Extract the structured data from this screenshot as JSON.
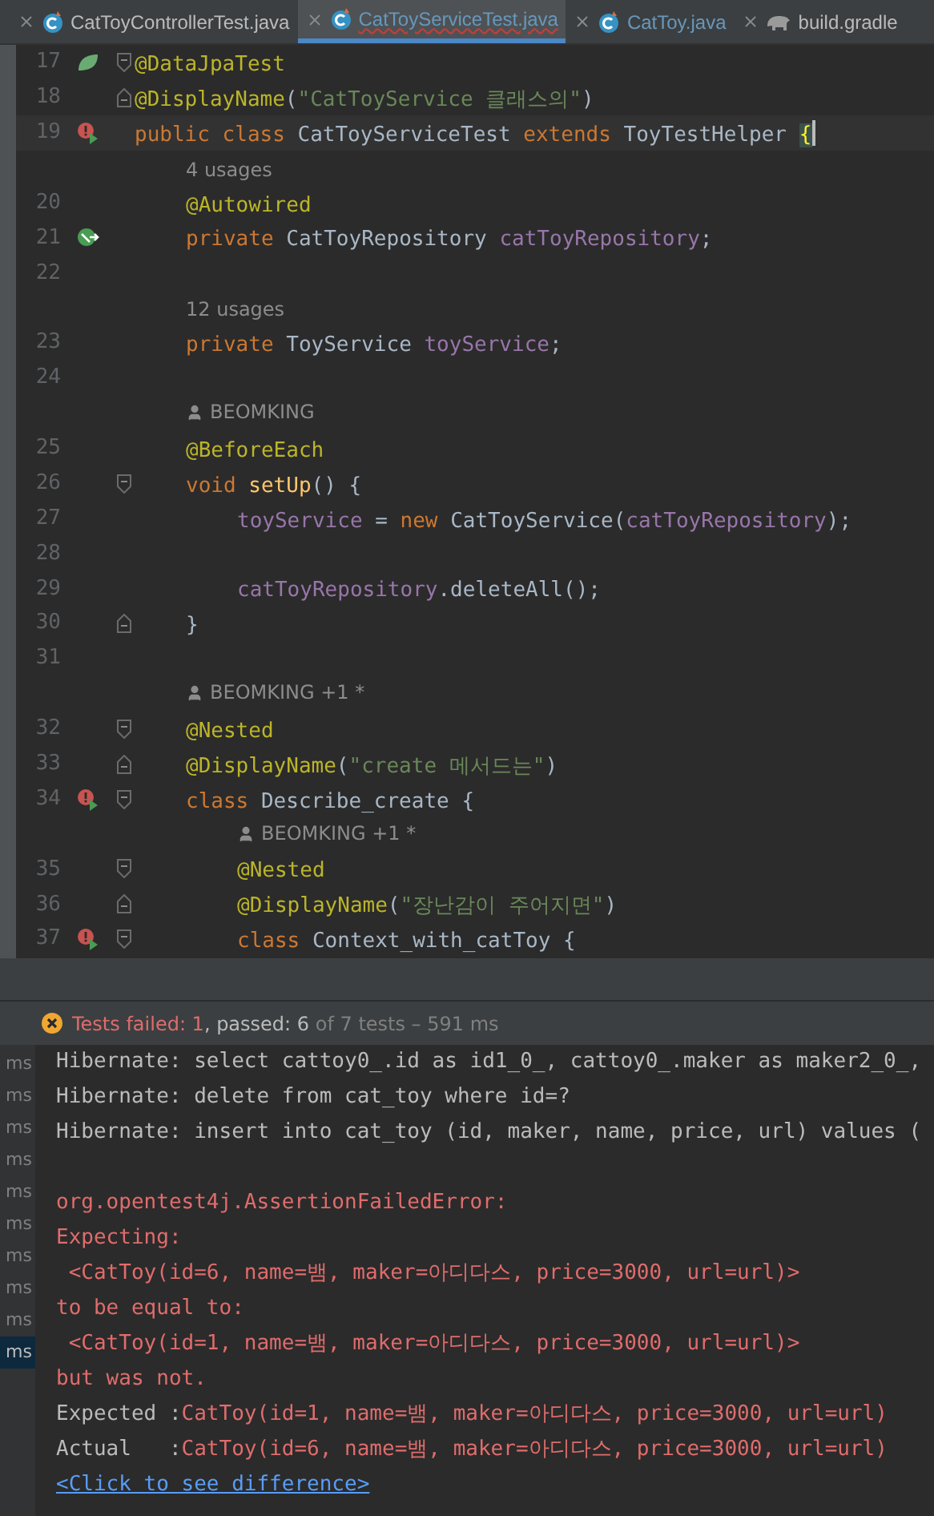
{
  "tabs": [
    {
      "label": "CatToyControllerTest.java",
      "kind": "class",
      "selected": false,
      "modified": false,
      "has_errors": false
    },
    {
      "label": "CatToyServiceTest.java",
      "kind": "class",
      "selected": true,
      "modified": true,
      "has_errors": true
    },
    {
      "label": "CatToy.java",
      "kind": "class",
      "selected": false,
      "modified": true,
      "has_errors": false
    },
    {
      "label": "build.gradle",
      "kind": "gradle",
      "selected": false,
      "modified": false,
      "has_errors": false
    }
  ],
  "editor": {
    "lines": [
      {
        "kind": "code",
        "number": "17",
        "gutter": {
          "kind": "spring"
        },
        "fold": {
          "kind": "start"
        },
        "current": false,
        "tokens": [
          {
            "kind": "ann",
            "text": "@DataJpaTest"
          }
        ]
      },
      {
        "kind": "code",
        "number": "18",
        "fold": {
          "kind": "end"
        },
        "current": false,
        "tokens": [
          {
            "kind": "ann",
            "text": "@DisplayName"
          },
          {
            "kind": "plain",
            "text": "("
          },
          {
            "kind": "str",
            "text": "\"CatToyService 클래스의\""
          },
          {
            "kind": "plain",
            "text": ")"
          }
        ]
      },
      {
        "kind": "code",
        "number": "19",
        "gutter": {
          "kind": "error-run"
        },
        "current": true,
        "tokens": [
          {
            "kind": "kw",
            "text": "public class "
          },
          {
            "kind": "plain",
            "text": "CatToyServiceTest "
          },
          {
            "kind": "kw",
            "text": "extends "
          },
          {
            "kind": "plain",
            "text": "ToyTestHelper "
          },
          {
            "kind": "brace",
            "text": "{"
          }
        ],
        "children": [
          {
            "kind": "hint",
            "text": "4 usages"
          },
          {
            "kind": "code",
            "number": "20",
            "current": false,
            "tokens": [
              {
                "kind": "ann",
                "text": "@Autowired"
              }
            ]
          },
          {
            "kind": "code",
            "number": "21",
            "gutter": {
              "kind": "autowire"
            },
            "current": false,
            "tokens": [
              {
                "kind": "kw",
                "text": "private "
              },
              {
                "kind": "plain",
                "text": "CatToyRepository "
              },
              {
                "kind": "field",
                "text": "catToyRepository"
              },
              {
                "kind": "plain",
                "text": ";"
              }
            ]
          },
          {
            "kind": "code",
            "number": "22",
            "current": false
          },
          {
            "kind": "hint",
            "text": "12 usages"
          },
          {
            "kind": "code",
            "number": "23",
            "current": false,
            "tokens": [
              {
                "kind": "kw",
                "text": "private "
              },
              {
                "kind": "plain",
                "text": "ToyService "
              },
              {
                "kind": "field",
                "text": "toyService"
              },
              {
                "kind": "plain",
                "text": ";"
              }
            ]
          },
          {
            "kind": "code",
            "number": "24",
            "current": false
          },
          {
            "kind": "author",
            "text": "BEOMKING"
          },
          {
            "kind": "code",
            "number": "25",
            "current": false,
            "tokens": [
              {
                "kind": "ann",
                "text": "@BeforeEach"
              }
            ]
          },
          {
            "kind": "code",
            "number": "26",
            "fold": {
              "kind": "start"
            },
            "current": false,
            "tokens": [
              {
                "kind": "kw",
                "text": "void "
              },
              {
                "kind": "method",
                "text": "setUp"
              },
              {
                "kind": "plain",
                "text": "() {"
              }
            ],
            "children": [
              {
                "kind": "code",
                "number": "27",
                "current": false,
                "tokens": [
                  {
                    "kind": "field",
                    "text": "toyService"
                  },
                  {
                    "kind": "plain",
                    "text": " = "
                  },
                  {
                    "kind": "kw",
                    "text": "new "
                  },
                  {
                    "kind": "plain",
                    "text": "CatToyService("
                  },
                  {
                    "kind": "field",
                    "text": "catToyRepository"
                  },
                  {
                    "kind": "plain",
                    "text": ");"
                  }
                ]
              },
              {
                "kind": "code",
                "number": "28",
                "current": false
              },
              {
                "kind": "code",
                "number": "29",
                "current": false,
                "tokens": [
                  {
                    "kind": "field",
                    "text": "catToyRepository"
                  },
                  {
                    "kind": "plain",
                    "text": ".deleteAll();"
                  }
                ]
              }
            ]
          },
          {
            "kind": "code",
            "number": "30",
            "fold": {
              "kind": "end"
            },
            "current": false,
            "tokens": [
              {
                "kind": "plain",
                "text": "}"
              }
            ]
          },
          {
            "kind": "code",
            "number": "31",
            "current": false
          },
          {
            "kind": "author",
            "text": "BEOMKING +1 *"
          },
          {
            "kind": "code",
            "number": "32",
            "fold": {
              "kind": "start"
            },
            "current": false,
            "tokens": [
              {
                "kind": "ann",
                "text": "@Nested"
              }
            ]
          },
          {
            "kind": "code",
            "number": "33",
            "fold": {
              "kind": "end"
            },
            "current": false,
            "tokens": [
              {
                "kind": "ann",
                "text": "@DisplayName"
              },
              {
                "kind": "plain",
                "text": "("
              },
              {
                "kind": "str",
                "text": "\"create 메서드는\""
              },
              {
                "kind": "plain",
                "text": ")"
              }
            ]
          },
          {
            "kind": "code",
            "number": "34",
            "gutter": {
              "kind": "error-run"
            },
            "fold": {
              "kind": "start"
            },
            "current": false,
            "tokens": [
              {
                "kind": "kw",
                "text": "class "
              },
              {
                "kind": "plain",
                "text": "Describe_create {"
              }
            ],
            "children": [
              {
                "kind": "author",
                "text": "BEOMKING +1 *"
              },
              {
                "kind": "code",
                "number": "35",
                "fold": {
                  "kind": "start"
                },
                "current": false,
                "tokens": [
                  {
                    "kind": "ann",
                    "text": "@Nested"
                  }
                ]
              },
              {
                "kind": "code",
                "number": "36",
                "fold": {
                  "kind": "end"
                },
                "current": false,
                "tokens": [
                  {
                    "kind": "ann",
                    "text": "@DisplayName"
                  },
                  {
                    "kind": "plain",
                    "text": "("
                  },
                  {
                    "kind": "str",
                    "text": "\"장난감이 주어지면\""
                  },
                  {
                    "kind": "plain",
                    "text": ")"
                  }
                ]
              },
              {
                "kind": "code",
                "number": "37",
                "gutter": {
                  "kind": "error-run"
                },
                "fold": {
                  "kind": "start"
                },
                "current": false,
                "tokens": [
                  {
                    "kind": "kw",
                    "text": "class "
                  },
                  {
                    "kind": "plain",
                    "text": "Context_with_catToy {"
                  }
                ]
              }
            ]
          }
        ]
      }
    ]
  },
  "status": [
    {
      "kind": "failed",
      "text": "Tests failed: 1"
    },
    {
      "kind": "passed",
      "text": ", passed: 6"
    },
    {
      "kind": "muted",
      "text": " of 7 tests – 591 ms"
    }
  ],
  "durations": [
    {
      "text": "ms",
      "selected": false
    },
    {
      "text": "ms",
      "selected": false
    },
    {
      "text": "ms",
      "selected": false
    },
    {
      "text": "ms",
      "selected": false
    },
    {
      "text": "ms",
      "selected": false
    },
    {
      "text": "ms",
      "selected": false
    },
    {
      "text": "ms",
      "selected": false
    },
    {
      "text": "ms",
      "selected": false
    },
    {
      "text": "ms",
      "selected": false
    },
    {
      "text": "ms",
      "selected": true
    }
  ],
  "console": [
    {
      "kind": "out",
      "text": "Hibernate: select cattoy0_.id as id1_0_, cattoy0_.maker as maker2_0_,"
    },
    {
      "kind": "out",
      "text": "Hibernate: delete from cat_toy where id=?"
    },
    {
      "kind": "out",
      "text": "Hibernate: insert into cat_toy (id, maker, name, price, url) values ("
    },
    {
      "kind": "blank"
    },
    {
      "kind": "error",
      "text": "org.opentest4j.AssertionFailedError:"
    },
    {
      "kind": "error",
      "text": "Expecting:"
    },
    {
      "kind": "error",
      "text": " <CatToy(id=6, name=뱀, maker=아디다스, price=3000, url=url)>"
    },
    {
      "kind": "error",
      "text": "to be equal to:"
    },
    {
      "kind": "error",
      "text": " <CatToy(id=1, name=뱀, maker=아디다스, price=3000, url=url)>"
    },
    {
      "kind": "error",
      "text": "but was not."
    },
    {
      "kind": "compare",
      "label": "Expected :",
      "text": "CatToy(id=1, name=뱀, maker=아디다스, price=3000, url=url)"
    },
    {
      "kind": "compare",
      "label": "Actual   :",
      "text": "CatToy(id=6, name=뱀, maker=아디다스, price=3000, url=url)"
    },
    {
      "kind": "link",
      "text": "<Click to see difference>"
    }
  ]
}
